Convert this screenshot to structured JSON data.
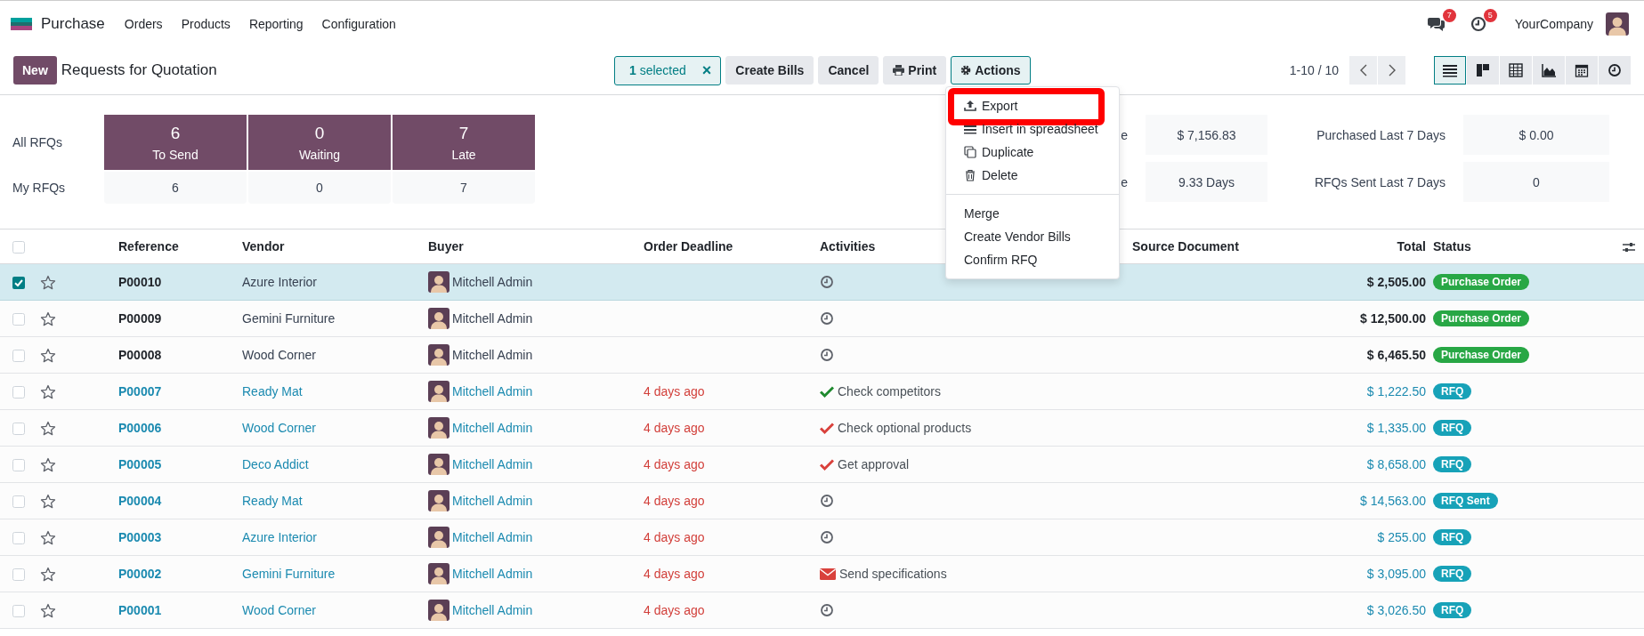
{
  "navbar": {
    "app": "Purchase",
    "menus": [
      "Orders",
      "Products",
      "Reporting",
      "Configuration"
    ],
    "messages_badge": "7",
    "activities_badge": "5",
    "company": "YourCompany"
  },
  "control_panel": {
    "new_button": "New",
    "title": "Requests for Quotation",
    "selection": "**1** selected",
    "clear": "×",
    "buttons": [
      {
        "label": "Create Bills",
        "kind": "plain",
        "expanded": false
      },
      {
        "label": "Cancel",
        "kind": "plain",
        "expanded": false
      },
      {
        "label": "Print",
        "kind": "print",
        "expanded": false
      },
      {
        "label": "Actions",
        "kind": "actions",
        "expanded": true
      }
    ],
    "pager": "1-10 / 10",
    "views": [
      {
        "kind": "list",
        "selected": true
      },
      {
        "kind": "kanban",
        "selected": false
      },
      {
        "kind": "pivot",
        "selected": false
      },
      {
        "kind": "graph",
        "selected": false
      },
      {
        "kind": "calendar",
        "selected": false
      },
      {
        "kind": "activity",
        "selected": false
      }
    ]
  },
  "dashboard": {
    "row_labels": [
      "All RFQs",
      "My RFQs"
    ],
    "tiles": [
      {
        "count": "6",
        "label": "To Send",
        "mine": "6"
      },
      {
        "count": "0",
        "label": "Waiting",
        "mine": "0"
      },
      {
        "count": "7",
        "label": "Late",
        "mine": "7"
      }
    ],
    "stats": [
      {
        "label": "e",
        "value": "$ 7,156.83",
        "label_2": "Purchased Last 7 Days",
        "value_2": "$ 0.00"
      },
      {
        "label": "e",
        "value": "9.33 Days",
        "label_2": "RFQs Sent Last 7 Days",
        "value_2": "0"
      }
    ]
  },
  "action_menu": {
    "items": [
      {
        "label": "Export",
        "kind": "export",
        "highlighted": true
      },
      {
        "label": "Insert in spreadsheet",
        "kind": "spreadsheet",
        "highlighted": false
      },
      {
        "label": "Duplicate",
        "kind": "duplicate",
        "highlighted": false
      },
      {
        "label": "Delete",
        "kind": "delete",
        "highlighted": false
      },
      {
        "label": "Merge",
        "kind": "divided",
        "highlighted": false
      },
      {
        "label": "Create Vendor Bills",
        "kind": "plain",
        "highlighted": false
      },
      {
        "label": "Confirm RFQ",
        "kind": "plain",
        "highlighted": false
      }
    ]
  },
  "table": {
    "select_all_checked": false,
    "columns": [
      "Reference",
      "Vendor",
      "Buyer",
      "Order Deadline",
      "Activities",
      "Source Document",
      "Total",
      "Status"
    ],
    "rows": [
      {
        "selected": true,
        "starred": false,
        "kind": "order",
        "reference": "P00010",
        "vendor": "Azure Interior",
        "buyer": "Mitchell Admin",
        "activity": {
          "kind": "clock"
        },
        "total": "$ 2,505.00",
        "status": {
          "label": "Purchase Order",
          "color": "#28a745"
        }
      },
      {
        "selected": false,
        "starred": false,
        "kind": "order",
        "reference": "P00009",
        "vendor": "Gemini Furniture",
        "buyer": "Mitchell Admin",
        "activity": {
          "kind": "clock"
        },
        "total": "$ 12,500.00",
        "status": {
          "label": "Purchase Order",
          "color": "#28a745"
        }
      },
      {
        "selected": false,
        "starred": false,
        "kind": "order",
        "reference": "P00008",
        "vendor": "Wood Corner",
        "buyer": "Mitchell Admin",
        "activity": {
          "kind": "clock"
        },
        "total": "$ 6,465.50",
        "status": {
          "label": "Purchase Order",
          "color": "#28a745"
        }
      },
      {
        "selected": false,
        "starred": false,
        "kind": "rfq",
        "reference": "P00007",
        "vendor": "Ready Mat",
        "buyer": "Mitchell Admin",
        "deadline": "4 days ago",
        "activity": {
          "kind": "todo",
          "text": "Check competitors",
          "color": "#1f8a2f"
        },
        "total": "$ 1,222.50",
        "status": {
          "label": "RFQ",
          "color": "#17a2b8"
        }
      },
      {
        "selected": false,
        "starred": false,
        "kind": "rfq",
        "reference": "P00006",
        "vendor": "Wood Corner",
        "buyer": "Mitchell Admin",
        "deadline": "4 days ago",
        "activity": {
          "kind": "todo",
          "text": "Check optional products",
          "color": "#d9413c"
        },
        "total": "$ 1,335.00",
        "status": {
          "label": "RFQ",
          "color": "#17a2b8"
        }
      },
      {
        "selected": false,
        "starred": false,
        "kind": "rfq",
        "reference": "P00005",
        "vendor": "Deco Addict",
        "buyer": "Mitchell Admin",
        "deadline": "4 days ago",
        "activity": {
          "kind": "todo",
          "text": "Get approval",
          "color": "#d9413c"
        },
        "total": "$ 8,658.00",
        "status": {
          "label": "RFQ",
          "color": "#17a2b8"
        }
      },
      {
        "selected": false,
        "starred": false,
        "kind": "rfq",
        "reference": "P00004",
        "vendor": "Ready Mat",
        "buyer": "Mitchell Admin",
        "deadline": "4 days ago",
        "activity": {
          "kind": "clock"
        },
        "total": "$ 14,563.00",
        "status": {
          "label": "RFQ Sent",
          "color": "#17a2b8"
        }
      },
      {
        "selected": false,
        "starred": false,
        "kind": "rfq",
        "reference": "P00003",
        "vendor": "Azure Interior",
        "buyer": "Mitchell Admin",
        "deadline": "4 days ago",
        "activity": {
          "kind": "clock"
        },
        "total": "$ 255.00",
        "status": {
          "label": "RFQ",
          "color": "#17a2b8"
        }
      },
      {
        "selected": false,
        "starred": false,
        "kind": "rfq",
        "reference": "P00002",
        "vendor": "Gemini Furniture",
        "buyer": "Mitchell Admin",
        "deadline": "4 days ago",
        "activity": {
          "kind": "email",
          "text": "Send specifications",
          "color": "#d9413c"
        },
        "total": "$ 3,095.00",
        "status": {
          "label": "RFQ",
          "color": "#17a2b8"
        }
      },
      {
        "selected": false,
        "starred": false,
        "kind": "rfq",
        "reference": "P00001",
        "vendor": "Wood Corner",
        "buyer": "Mitchell Admin",
        "deadline": "4 days ago",
        "activity": {
          "kind": "clock"
        },
        "total": "$ 3,026.50",
        "status": {
          "label": "RFQ",
          "color": "#17a2b8"
        }
      }
    ]
  }
}
